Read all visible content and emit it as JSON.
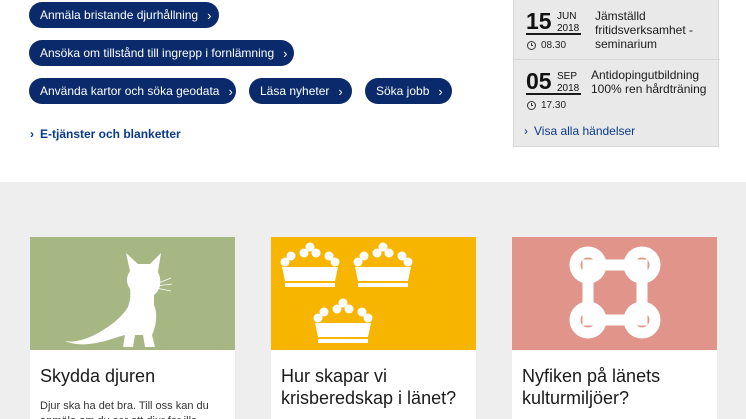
{
  "quick_links": [
    {
      "label": "Anmäla bristande djurhållning"
    },
    {
      "label": "Ansöka om tillstånd till ingrepp i fornlämning"
    },
    {
      "label": "Använda kartor och söka geodata"
    },
    {
      "label": "Läsa nyheter"
    },
    {
      "label": "Söka jobb"
    }
  ],
  "etjanster_link": "E-tjänster och blanketter",
  "events": {
    "items": [
      {
        "day": "15",
        "month": "JUN",
        "year": "2018",
        "time": "08.30",
        "title": "Jämställd fritidsverksamhet - seminarium"
      },
      {
        "day": "05",
        "month": "SEP",
        "year": "2018",
        "time": "17.30",
        "title": "Antidopingutbildning 100% ren hårdträning"
      }
    ],
    "all_label": "Visa alla händelser"
  },
  "cards": [
    {
      "title": "Skydda djuren",
      "text": "Djur ska ha det bra. Till oss kan du anmäla om du ser att djur far illa.",
      "bg": "#a7b784",
      "icon": "kitten-icon"
    },
    {
      "title": "Hur skapar vi krisberedskap i länet?",
      "text": "",
      "bg": "#f7b500",
      "icon": "three-crowns-icon"
    },
    {
      "title": "Nyfiken på länets kulturmiljöer?",
      "text": "",
      "bg": "#e0948a",
      "icon": "place-of-interest-icon"
    }
  ],
  "colors": {
    "pill_bg": "#0a2a6b",
    "link": "#0a3a8a",
    "grey_band": "#eeeeee"
  }
}
